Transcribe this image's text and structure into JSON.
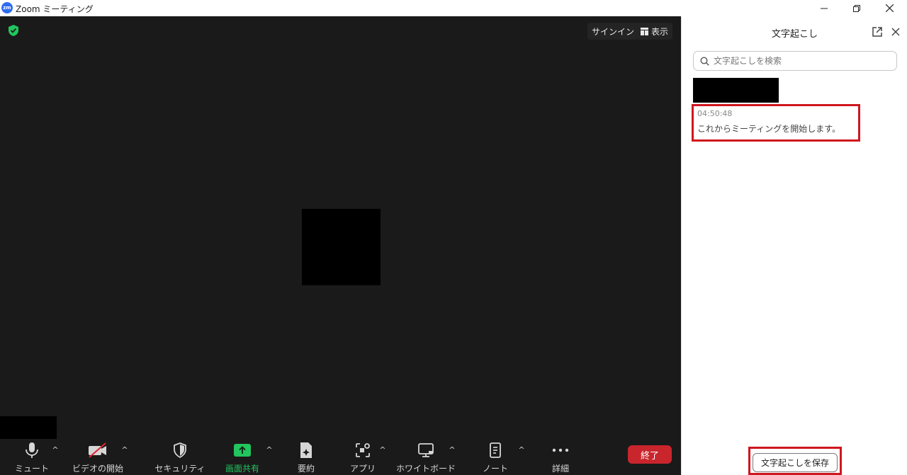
{
  "window": {
    "logo_text": "zm",
    "title": "Zoom ミーティング",
    "minimize_icon": "minimize-icon",
    "maximize_icon": "restore-icon",
    "close_icon": "close-icon"
  },
  "meeting": {
    "security_badge_icon": "shield-check-icon",
    "signin_label": "サインイン",
    "view_label": "表示",
    "view_icon": "grid-icon"
  },
  "toolbar": {
    "items": [
      {
        "label": "ミュート",
        "icon": "microphone-icon",
        "has_caret": true
      },
      {
        "label": "ビデオの開始",
        "icon": "video-off-icon",
        "has_caret": true
      },
      {
        "label": "セキュリティ",
        "icon": "shield-icon",
        "has_caret": false
      },
      {
        "label": "画面共有",
        "icon": "share-screen-icon",
        "has_caret": true
      },
      {
        "label": "要約",
        "icon": "summary-icon",
        "has_caret": false
      },
      {
        "label": "アプリ",
        "icon": "apps-icon",
        "has_caret": true
      },
      {
        "label": "ホワイトボード",
        "icon": "whiteboard-icon",
        "has_caret": true
      },
      {
        "label": "ノート",
        "icon": "notes-icon",
        "has_caret": true
      },
      {
        "label": "詳細",
        "icon": "more-icon",
        "has_caret": false
      }
    ],
    "end_label": "終了",
    "colors": {
      "share": "#22c55e",
      "end": "#c9252c"
    }
  },
  "transcript": {
    "title": "文字起こし",
    "search_placeholder": "文字起こしを検索",
    "entries": [
      {
        "time": "04:50:48",
        "text": "これからミーティングを開始します。"
      }
    ],
    "save_label": "文字起こしを保存",
    "highlight_color": "#d0161e"
  }
}
